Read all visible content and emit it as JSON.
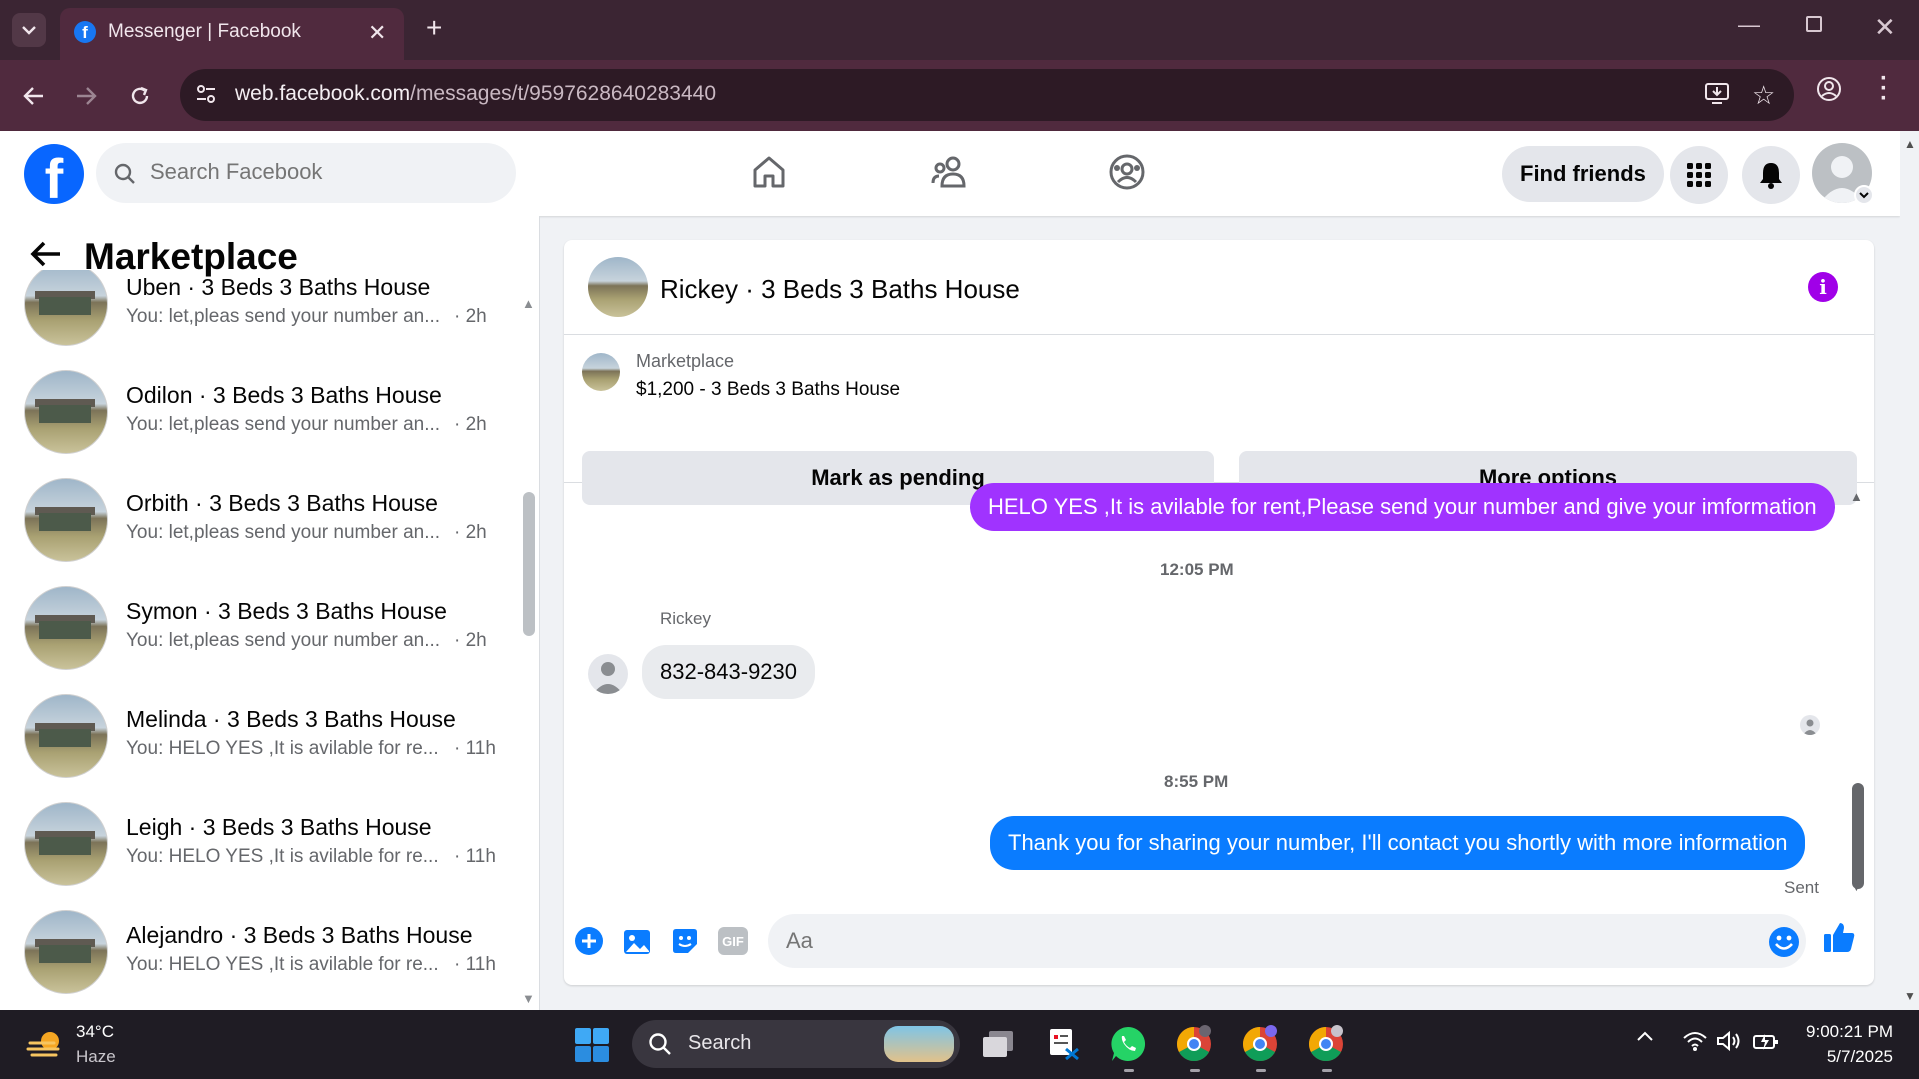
{
  "browser": {
    "tab_title": "Messenger | Facebook",
    "url_host": "web.facebook.com",
    "url_path": "/messages/t/9597628640283440"
  },
  "header": {
    "search_placeholder": "Search Facebook",
    "find_friends_label": "Find friends"
  },
  "sidebar": {
    "title": "Marketplace",
    "conversations": [
      {
        "name": "Uben · 3 Beds 3 Baths House",
        "preview": "You: let,pleas send your number an...",
        "time": "· 2h"
      },
      {
        "name": "Odilon · 3 Beds 3 Baths House",
        "preview": "You: let,pleas send your number an...",
        "time": "· 2h"
      },
      {
        "name": "Orbith · 3 Beds 3 Baths House",
        "preview": "You: let,pleas send your number an...",
        "time": "· 2h"
      },
      {
        "name": "Symon · 3 Beds 3 Baths House",
        "preview": "You: let,pleas send your number an...",
        "time": "· 2h"
      },
      {
        "name": "Melinda · 3 Beds 3 Baths House",
        "preview": "You: HELO YES ,It is avilable for re...",
        "time": "· 11h"
      },
      {
        "name": "Leigh · 3 Beds 3 Baths House",
        "preview": "You: HELO YES ,It is avilable for re...",
        "time": "· 11h"
      },
      {
        "name": "Alejandro · 3 Beds 3 Baths House",
        "preview": "You: HELO YES ,It is avilable for re...",
        "time": "· 11h"
      }
    ]
  },
  "chat": {
    "title": "Rickey · 3 Beds 3 Baths House",
    "listing_label": "Marketplace",
    "listing_price": "$1,200 - 3 Beds 3 Baths House",
    "mark_pending_label": "Mark as pending",
    "more_options_label": "More options",
    "messages": [
      {
        "text": "HELO YES ,It is avilable for rent,Please send your number and give your imformation"
      },
      {
        "text": "832-843-9230"
      },
      {
        "text": "Thank you for sharing your number, I'll contact you shortly with more information"
      }
    ],
    "time_1": "12:05 PM",
    "time_2": "8:55 PM",
    "sender_name": "Rickey",
    "sent_label": "Sent",
    "input_placeholder": "Aa",
    "gif_label": "GIF"
  },
  "taskbar": {
    "weather_temp": "34°C",
    "weather_desc": "Haze",
    "search_label": "Search",
    "clock_time": "9:00:21 PM",
    "clock_date": "5/7/2025"
  },
  "colors": {
    "fb_blue": "#0866ff",
    "outgoing_purple": "#a033ff",
    "outgoing_blue": "#0a7cff",
    "browser_chrome": "#502a3e"
  }
}
